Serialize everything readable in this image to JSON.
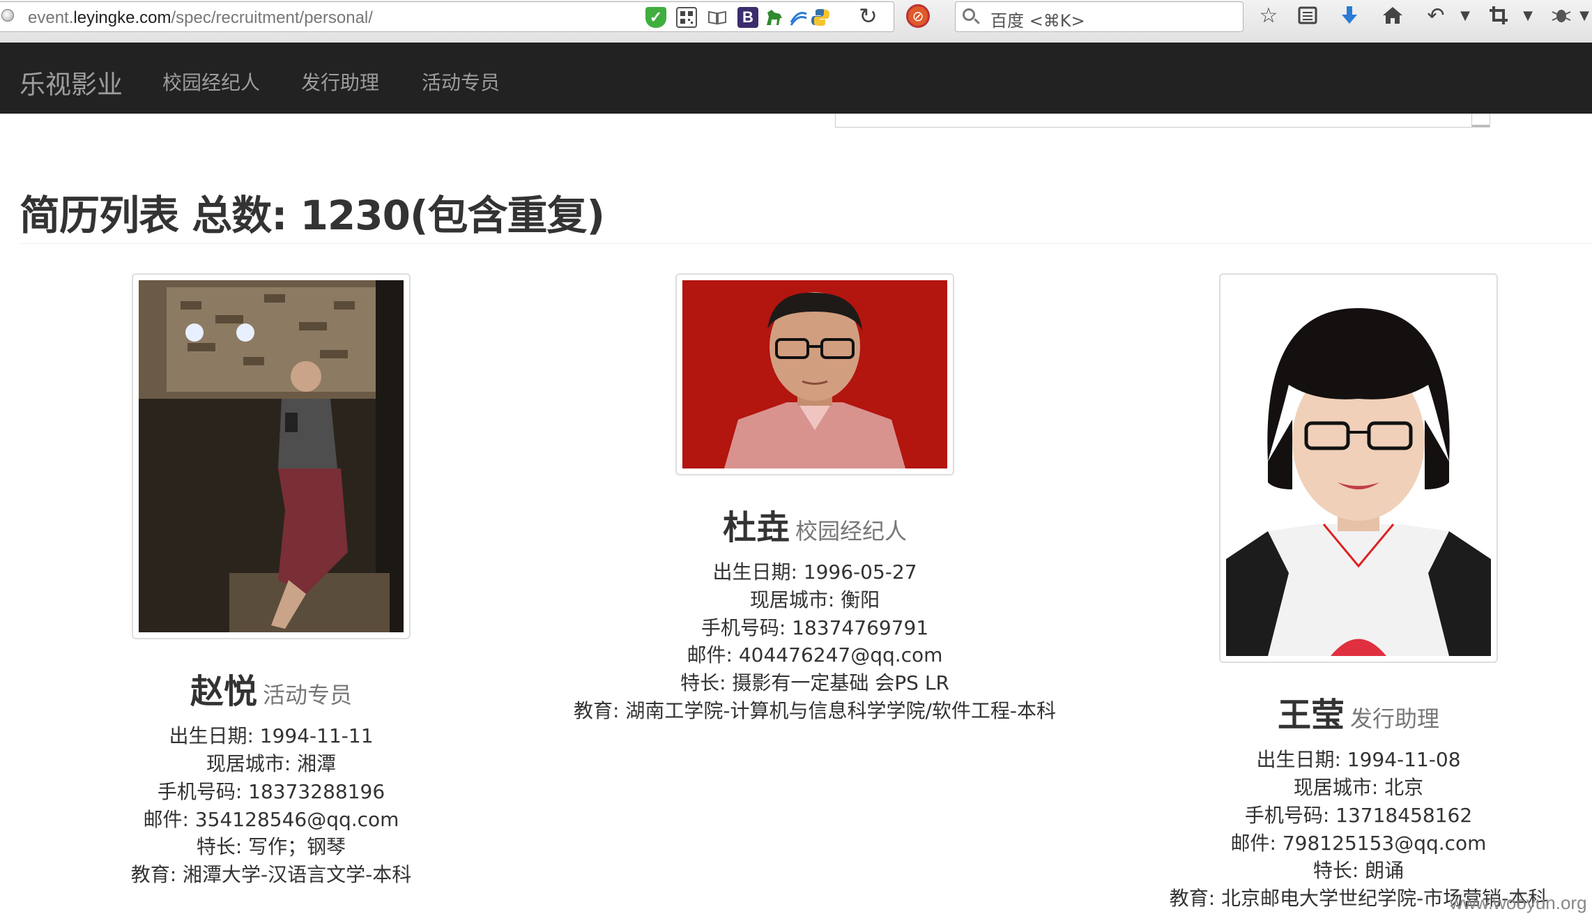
{
  "browser": {
    "url_prefix": "event.",
    "url_domain": "leyingke.com",
    "url_path": "/spec/recruitment/personal/",
    "search_placeholder": "百度 <⌘K>",
    "ext_b_label": "B"
  },
  "nav": {
    "brand": "乐视影业",
    "links": [
      "校园经纪人",
      "发行助理",
      "活动专员"
    ]
  },
  "page": {
    "title": "简历列表 总数: 1230(包含重复)"
  },
  "candidates": [
    {
      "name": "赵悦",
      "role": "活动专员",
      "birth": "出生日期: 1994-11-11",
      "city": "现居城市: 湘潭",
      "phone": "手机号码: 18373288196",
      "email": "邮件: 354128546@qq.com",
      "skill": "特长: 写作；钢琴",
      "education": "教育: 湘潭大学-汉语言文学-本科"
    },
    {
      "name": "杜垚",
      "role": "校园经纪人",
      "birth": "出生日期: 1996-05-27",
      "city": "现居城市: 衡阳",
      "phone": "手机号码: 18374769791",
      "email": "邮件: 404476247@qq.com",
      "skill": "特长: 摄影有一定基础 会PS LR",
      "education": "教育: 湖南工学院-计算机与信息科学学院/软件工程-本科"
    },
    {
      "name": "王莹",
      "role": "发行助理",
      "birth": "出生日期: 1994-11-08",
      "city": "现居城市: 北京",
      "phone": "手机号码: 13718458162",
      "email": "邮件: 798125153@qq.com",
      "skill": "特长: 朗诵",
      "education": "教育: 北京邮电大学世纪学院-市场营销-本科"
    }
  ],
  "watermark": "www.wooyun.org"
}
